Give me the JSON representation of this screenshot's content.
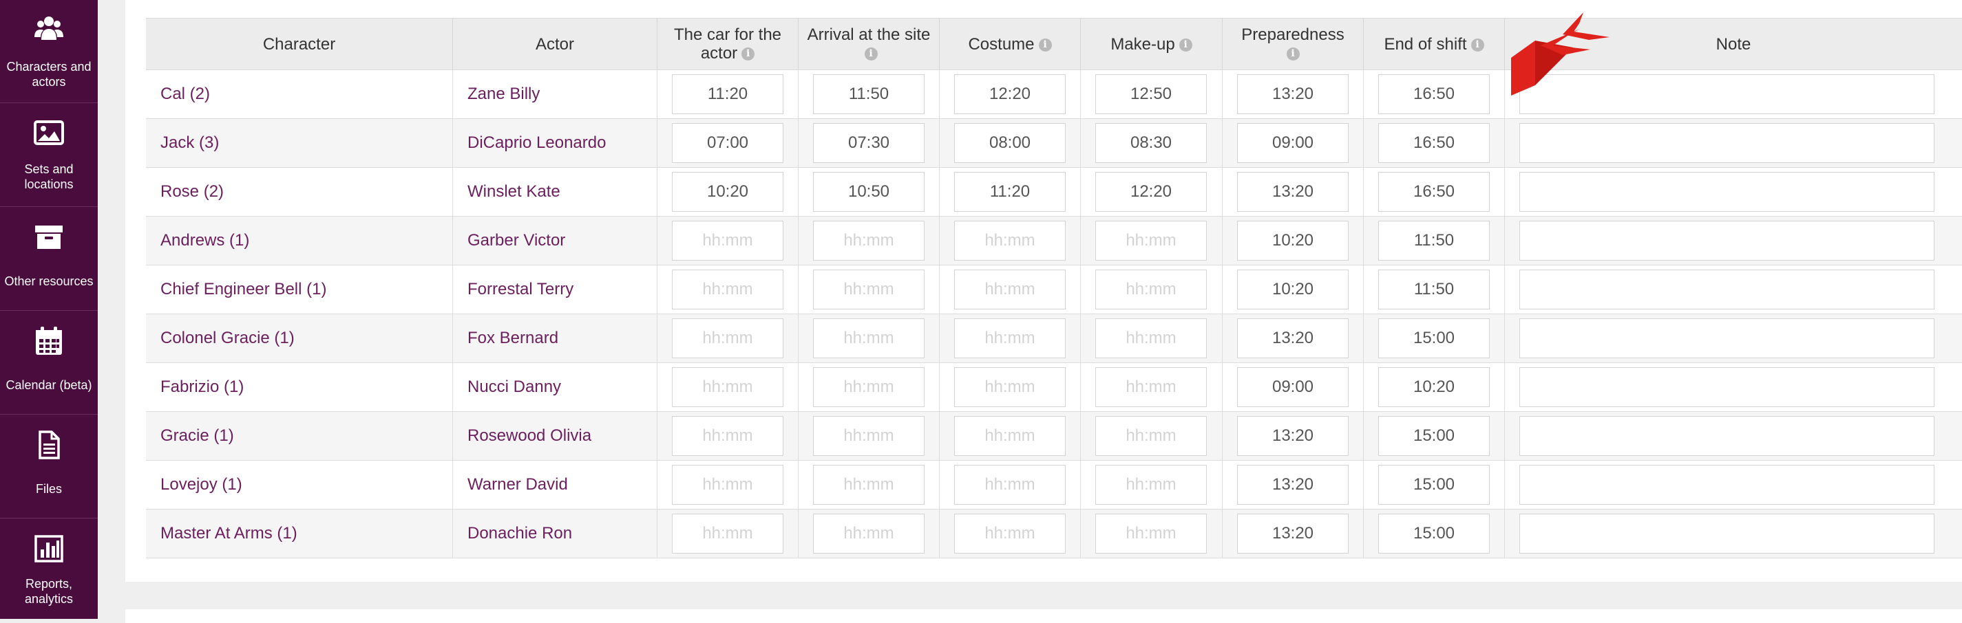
{
  "sidebar": {
    "items": [
      {
        "label": "Characters and actors",
        "icon": "users-icon"
      },
      {
        "label": "Sets and locations",
        "icon": "image-icon"
      },
      {
        "label": "Other resources",
        "icon": "archive-box-icon"
      },
      {
        "label": "Calendar (beta)",
        "icon": "calendar-icon"
      },
      {
        "label": "Files",
        "icon": "file-icon"
      },
      {
        "label": "Reports, analytics",
        "icon": "bar-chart-icon"
      }
    ]
  },
  "table": {
    "headers": {
      "character": "Character",
      "actor": "Actor",
      "car": "The car for the actor",
      "arrival": "Arrival at the site",
      "costume": "Costume",
      "makeup": "Make-up",
      "preparedness": "Preparedness",
      "end_shift": "End of shift",
      "note": "Note"
    },
    "time_placeholder": "hh:mm",
    "rows": [
      {
        "character": "Cal (2)",
        "actor": "Zane Billy",
        "times": [
          "11:20",
          "11:50",
          "12:20",
          "12:50",
          "13:20",
          "16:50"
        ],
        "note": ""
      },
      {
        "character": "Jack (3)",
        "actor": "DiCaprio Leonardo",
        "times": [
          "07:00",
          "07:30",
          "08:00",
          "08:30",
          "09:00",
          "16:50"
        ],
        "note": ""
      },
      {
        "character": "Rose (2)",
        "actor": "Winslet Kate",
        "times": [
          "10:20",
          "10:50",
          "11:20",
          "12:20",
          "13:20",
          "16:50"
        ],
        "note": ""
      },
      {
        "character": "Andrews (1)",
        "actor": "Garber Victor",
        "times": [
          "",
          "",
          "",
          "",
          "10:20",
          "11:50"
        ],
        "note": ""
      },
      {
        "character": "Chief Engineer Bell (1)",
        "actor": "Forrestal Terry",
        "times": [
          "",
          "",
          "",
          "",
          "10:20",
          "11:50"
        ],
        "note": ""
      },
      {
        "character": "Colonel Gracie (1)",
        "actor": "Fox Bernard",
        "times": [
          "",
          "",
          "",
          "",
          "13:20",
          "15:00"
        ],
        "note": ""
      },
      {
        "character": "Fabrizio (1)",
        "actor": "Nucci Danny",
        "times": [
          "",
          "",
          "",
          "",
          "09:00",
          "10:20"
        ],
        "note": ""
      },
      {
        "character": "Gracie (1)",
        "actor": "Rosewood Olivia",
        "times": [
          "",
          "",
          "",
          "",
          "13:20",
          "15:00"
        ],
        "note": ""
      },
      {
        "character": "Lovejoy (1)",
        "actor": "Warner David",
        "times": [
          "",
          "",
          "",
          "",
          "13:20",
          "15:00"
        ],
        "note": ""
      },
      {
        "character": "Master At Arms (1)",
        "actor": "Donachie Ron",
        "times": [
          "",
          "",
          "",
          "",
          "13:20",
          "15:00"
        ],
        "note": ""
      }
    ]
  },
  "colors": {
    "sidebar_bg": "#4a0c3c",
    "link": "#6b1f5d",
    "arrow": "#e0221c"
  }
}
